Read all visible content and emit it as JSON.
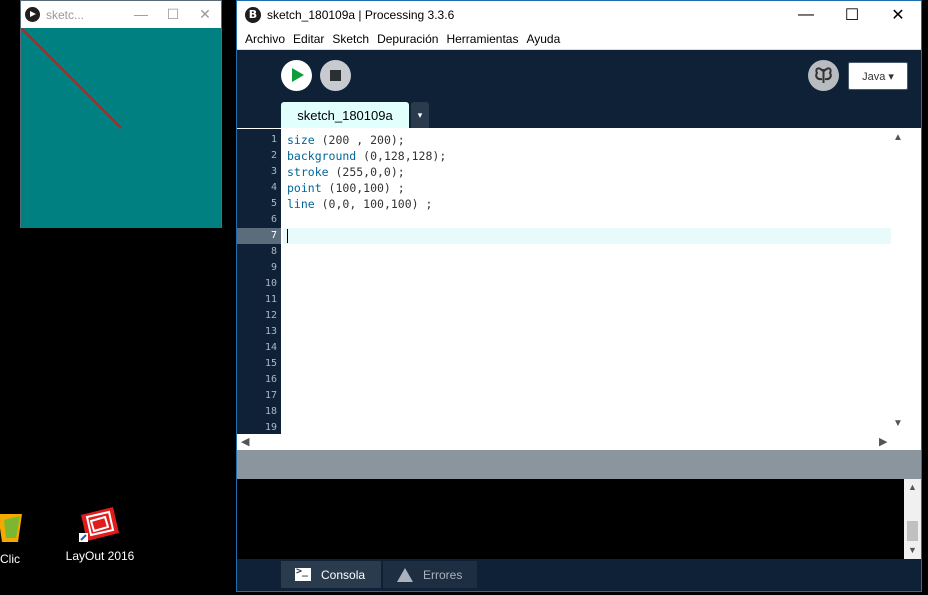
{
  "desktop": {
    "icons": [
      {
        "label": "Clic"
      },
      {
        "label": "LayOut 2016"
      }
    ]
  },
  "sketch_window": {
    "title": "sketc...",
    "controls": {
      "minimize": "—",
      "maximize": "☐",
      "close": "✕"
    },
    "canvas": {
      "background": "#008080",
      "stroke": "#ff0000"
    }
  },
  "main_window": {
    "title": "sketch_180109a | Processing 3.3.6",
    "logo": "B",
    "controls": {
      "minimize": "—",
      "maximize": "☐",
      "close": "✕"
    },
    "menu": [
      "Archivo",
      "Editar",
      "Sketch",
      "Depuración",
      "Herramientas",
      "Ayuda"
    ],
    "toolbar": {
      "debug_icon": "butterfly-icon",
      "mode": "Java ▾"
    },
    "tab": {
      "name": "sketch_180109a",
      "menu": "▾"
    },
    "editor": {
      "line_numbers": [
        "1",
        "2",
        "3",
        "4",
        "5",
        "6",
        "7",
        "8",
        "9",
        "10",
        "11",
        "12",
        "13",
        "14",
        "15",
        "16",
        "17",
        "18",
        "19"
      ],
      "current_line": 7,
      "lines": [
        {
          "fn": "size",
          "args": " (200 , 200);"
        },
        {
          "fn": "background",
          "args": " (0,128,128);"
        },
        {
          "fn": "stroke",
          "args": " (255,0,0);"
        },
        {
          "fn": "point",
          "args": " (100,100) ;"
        },
        {
          "fn": "line",
          "args": " (0,0, 100,100) ;"
        }
      ]
    },
    "footer": {
      "console_tab": "Consola",
      "errors_tab": "Errores"
    }
  },
  "colors": {
    "accent": "#0e2137",
    "run": "#0c9d3a",
    "keyword": "#006699"
  }
}
